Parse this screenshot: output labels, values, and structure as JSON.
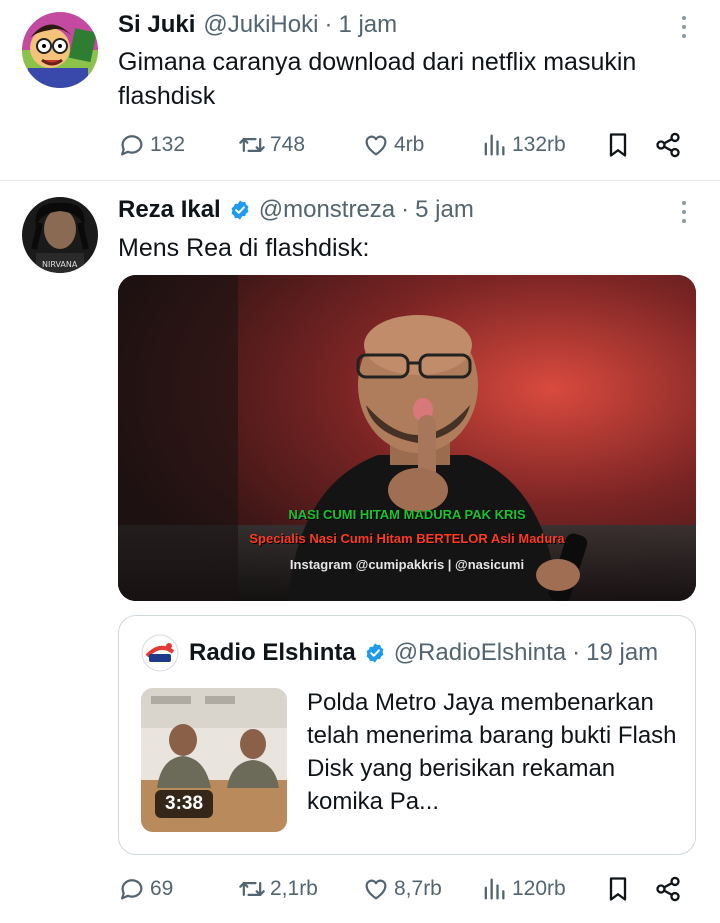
{
  "tweets": [
    {
      "name": "Si Juki",
      "handle": "@JukiHoki",
      "separator": "·",
      "time": "1 jam",
      "text": "Gimana caranya download dari netflix masukin flashdisk",
      "stats": {
        "replies": "132",
        "retweets": "748",
        "likes": "4rb",
        "views": "132rb"
      }
    },
    {
      "name": "Reza Ikal",
      "handle": "@monstreza",
      "separator": "·",
      "time": "5 jam",
      "text": "Mens Rea di flashdisk:",
      "media": {
        "caption_line1": "NASI CUMI HITAM MADURA PAK KRIS",
        "caption_line2": "Specialis Nasi Cumi Hitam BERTELOR Asli Madura",
        "caption_line3": "Instagram @cumipakkris | @nasicumi"
      },
      "quote": {
        "name": "Radio Elshinta",
        "handle": "@RadioElshinta",
        "separator": "·",
        "time": "19 jam",
        "text": "Polda Metro Jaya membenarkan telah menerima barang bukti Flash Disk yang berisikan rekaman komika Pa...",
        "video_duration": "3:38"
      },
      "stats": {
        "replies": "69",
        "retweets": "2,1rb",
        "likes": "8,7rb",
        "views": "120rb"
      }
    }
  ],
  "colors": {
    "text": "#0f1419",
    "secondary": "#536471",
    "verified": "#1d9bf0",
    "border": "#cfd9de"
  },
  "icons": [
    "reply-icon",
    "retweet-icon",
    "like-icon",
    "views-icon",
    "bookmark-icon",
    "share-icon",
    "verified-icon",
    "more-icon"
  ]
}
